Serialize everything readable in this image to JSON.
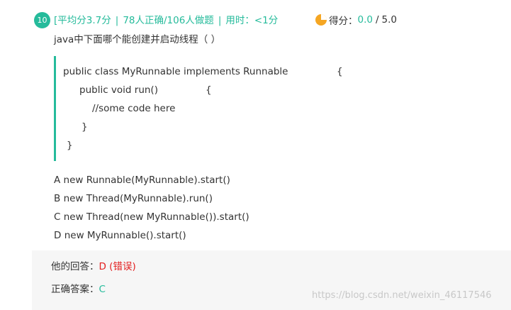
{
  "question": {
    "number": "10",
    "avg_score": "[平均分3.7分",
    "separator": "|",
    "correct_stats": "78人正确/106人做题",
    "time_label": "用时：<1分",
    "score_label": "得分：",
    "score_got": "0.0",
    "score_slash": "/",
    "score_total": "5.0",
    "text": "java中下面哪个能创建并启动线程（ ）"
  },
  "code": {
    "line1_text": "public class MyRunnable implements Runnable",
    "line1_brace": "{",
    "line2_text": "public void run()",
    "line2_brace": "{",
    "line3_text": "//some code here",
    "line4_text": "}",
    "line5_text": "}"
  },
  "options": [
    {
      "letter": "A",
      "text": "new Runnable(MyRunnable).start()"
    },
    {
      "letter": "B",
      "text": "new Thread(MyRunnable).run()"
    },
    {
      "letter": "C",
      "text": "new Thread(new MyRunnable()).start()"
    },
    {
      "letter": "D",
      "text": "new MyRunnable().start()"
    }
  ],
  "answer": {
    "your_label": "他的回答：",
    "your_value": "D (错误)",
    "correct_label": "正确答案：",
    "correct_value": "C"
  },
  "watermark": "https://blog.csdn.net/weixin_46117546",
  "colors": {
    "accent": "#25bb9b",
    "score_icon": "#f5a623",
    "wrong": "#e32020"
  },
  "icons": {
    "score": "pie-chart-icon"
  }
}
